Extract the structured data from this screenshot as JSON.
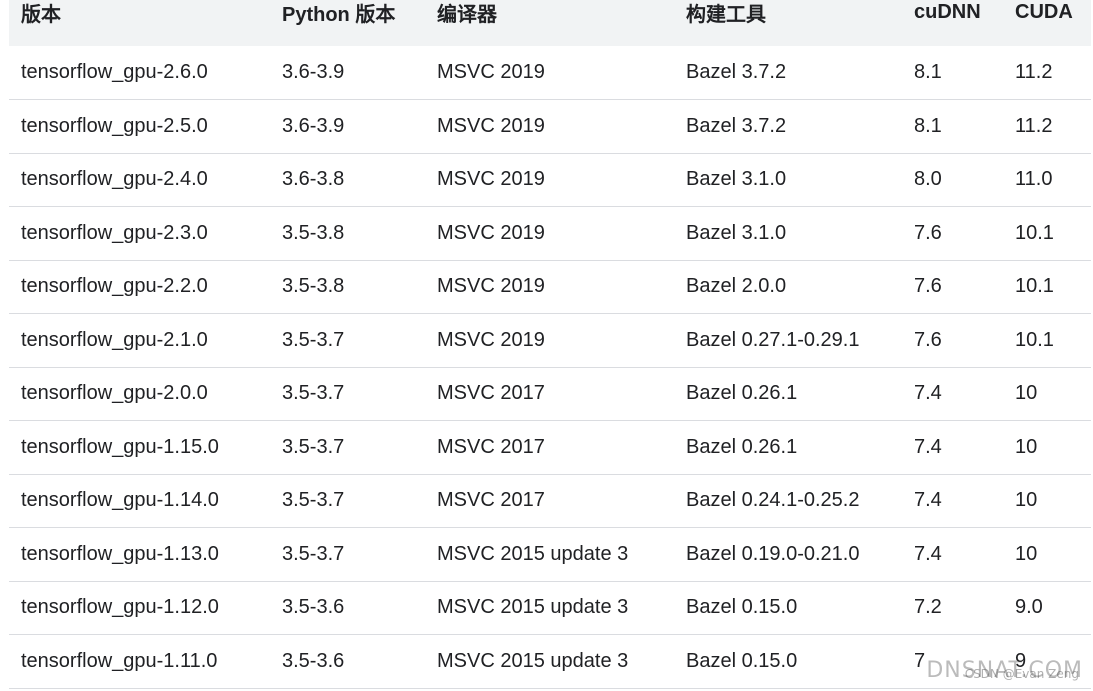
{
  "table": {
    "headers": [
      "版本",
      "Python 版本",
      "编译器",
      "构建工具",
      "cuDNN",
      "CUDA"
    ],
    "rows": [
      [
        "tensorflow_gpu-2.6.0",
        "3.6-3.9",
        "MSVC 2019",
        "Bazel 3.7.2",
        "8.1",
        "11.2"
      ],
      [
        "tensorflow_gpu-2.5.0",
        "3.6-3.9",
        "MSVC 2019",
        "Bazel 3.7.2",
        "8.1",
        "11.2"
      ],
      [
        "tensorflow_gpu-2.4.0",
        "3.6-3.8",
        "MSVC 2019",
        "Bazel 3.1.0",
        "8.0",
        "11.0"
      ],
      [
        "tensorflow_gpu-2.3.0",
        "3.5-3.8",
        "MSVC 2019",
        "Bazel 3.1.0",
        "7.6",
        "10.1"
      ],
      [
        "tensorflow_gpu-2.2.0",
        "3.5-3.8",
        "MSVC 2019",
        "Bazel 2.0.0",
        "7.6",
        "10.1"
      ],
      [
        "tensorflow_gpu-2.1.0",
        "3.5-3.7",
        "MSVC 2019",
        "Bazel 0.27.1-0.29.1",
        "7.6",
        "10.1"
      ],
      [
        "tensorflow_gpu-2.0.0",
        "3.5-3.7",
        "MSVC 2017",
        "Bazel 0.26.1",
        "7.4",
        "10"
      ],
      [
        "tensorflow_gpu-1.15.0",
        "3.5-3.7",
        "MSVC 2017",
        "Bazel 0.26.1",
        "7.4",
        "10"
      ],
      [
        "tensorflow_gpu-1.14.0",
        "3.5-3.7",
        "MSVC 2017",
        "Bazel 0.24.1-0.25.2",
        "7.4",
        "10"
      ],
      [
        "tensorflow_gpu-1.13.0",
        "3.5-3.7",
        "MSVC 2015 update 3",
        "Bazel 0.19.0-0.21.0",
        "7.4",
        "10"
      ],
      [
        "tensorflow_gpu-1.12.0",
        "3.5-3.6",
        "MSVC 2015 update 3",
        "Bazel 0.15.0",
        "7.2",
        "9.0"
      ],
      [
        "tensorflow_gpu-1.11.0",
        "3.5-3.6",
        "MSVC 2015 update 3",
        "Bazel 0.15.0",
        "7",
        "9"
      ]
    ]
  },
  "watermark": {
    "main": "DNSNAT.COM",
    "small": "CSDN @Evan Zeng"
  }
}
